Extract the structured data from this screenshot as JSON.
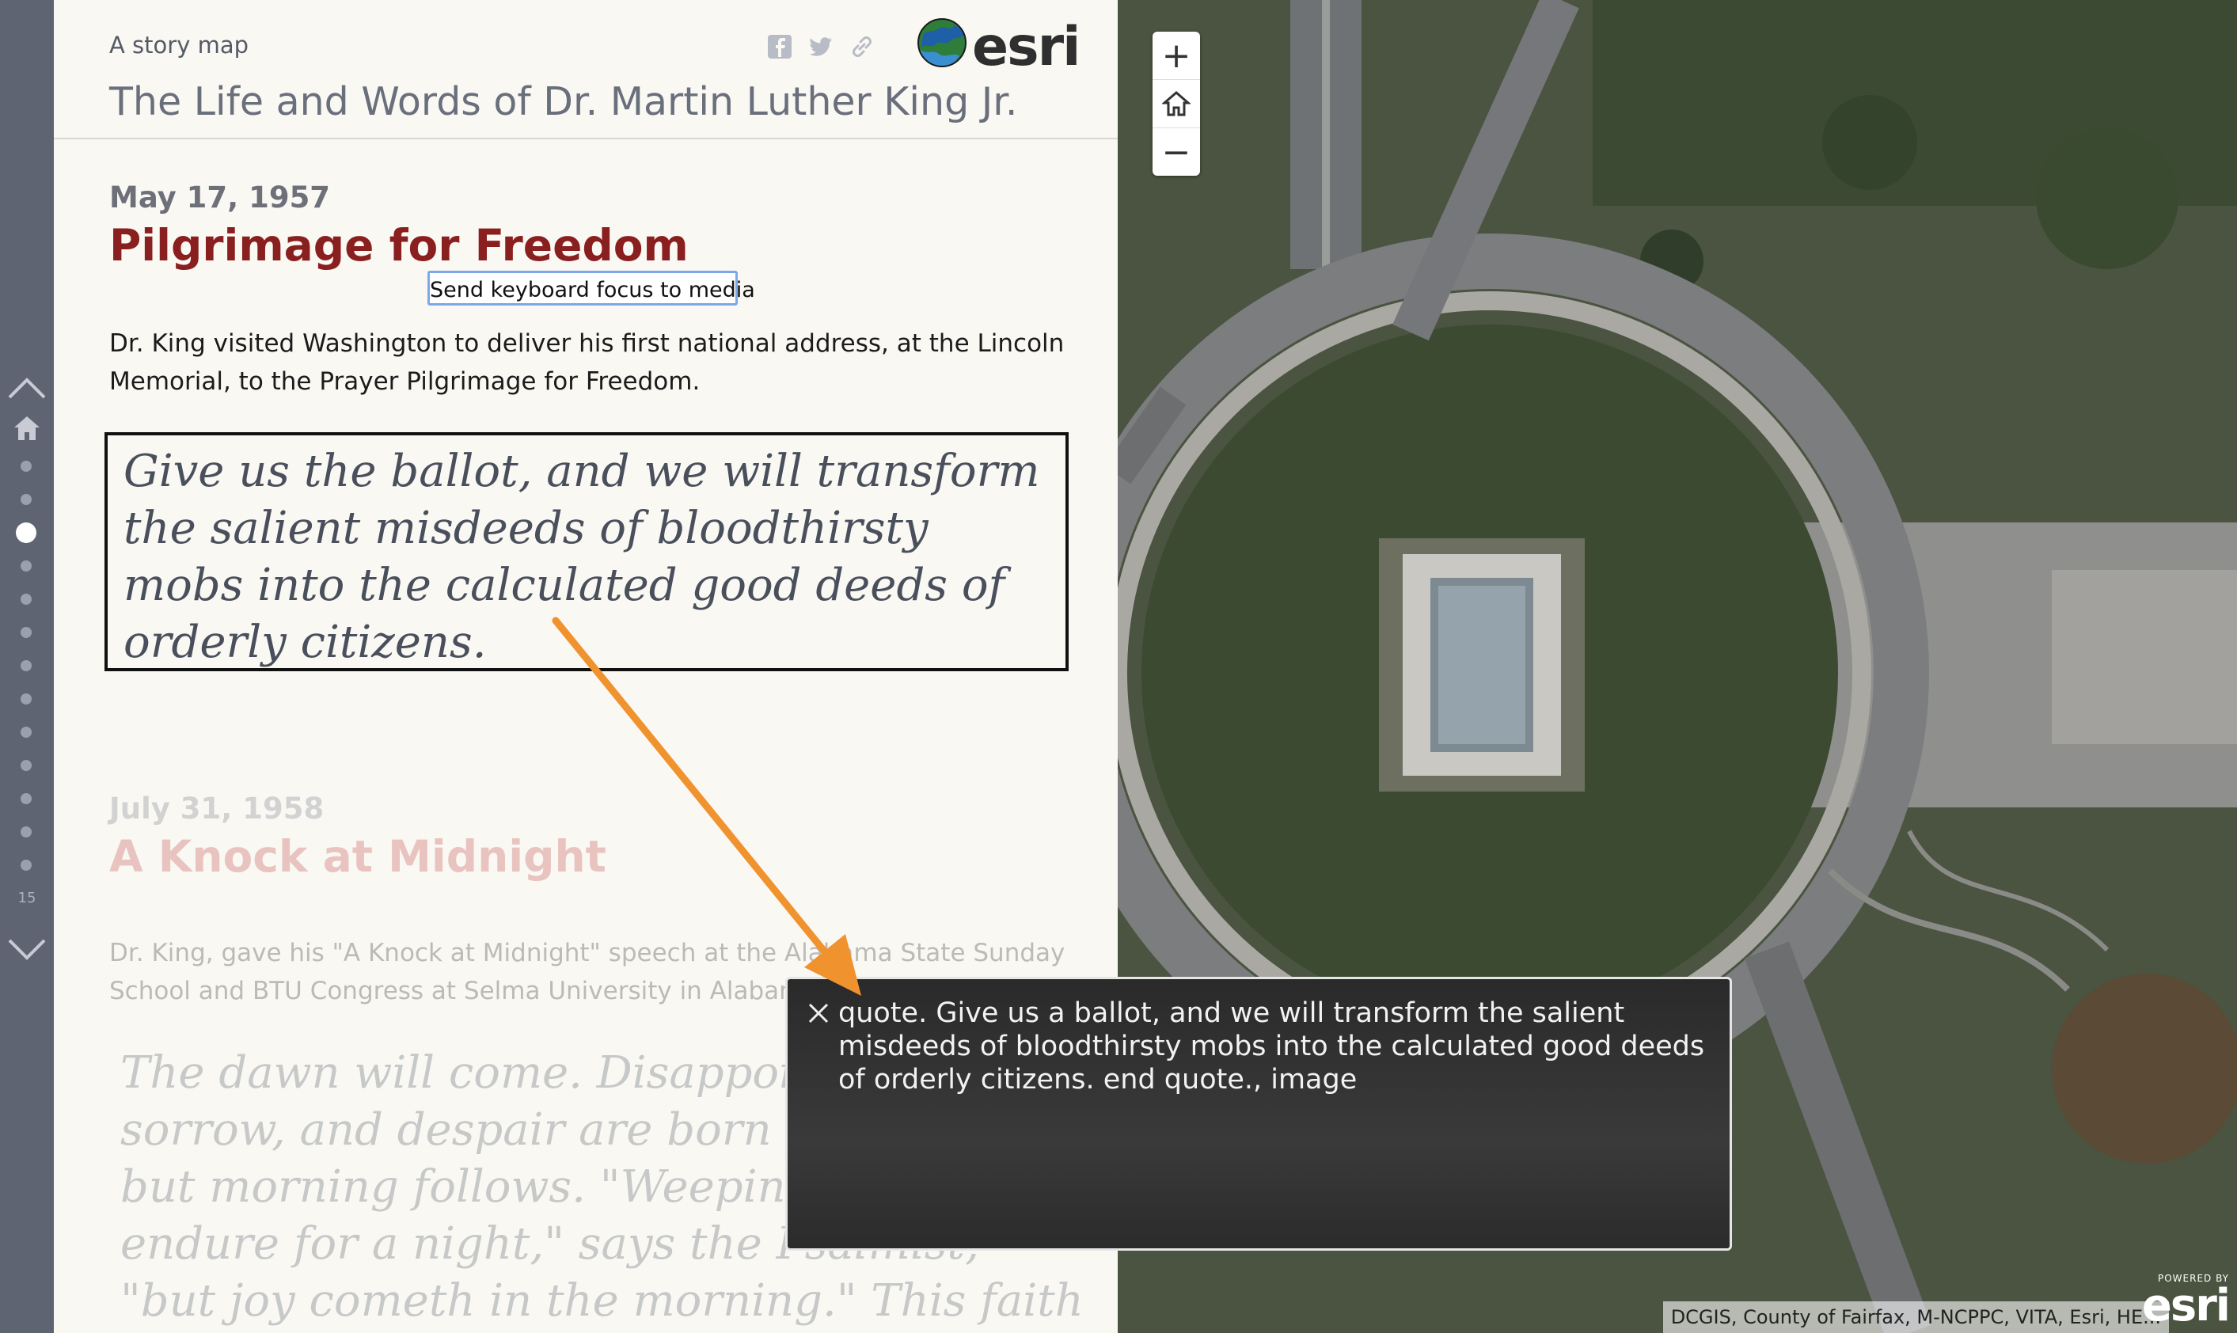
{
  "header": {
    "subtitle": "A story map",
    "title": "The Life and Words of Dr. Martin Luther King Jr.",
    "logo_text": "esri",
    "share_icons": [
      "facebook-icon",
      "twitter-icon",
      "link-icon"
    ]
  },
  "nav": {
    "count": "15",
    "active_index": 2
  },
  "sections": [
    {
      "date": "May 17, 1957",
      "headline": "Pilgrimage for Freedom",
      "focus_link": "Send keyboard focus to media",
      "body": "Dr. King visited Washington to deliver his first national address, at the Lincoln Memorial, to the Prayer Pilgrimage for Freedom.",
      "quote": "Give us the ballot, and we will transform the salient misdeeds of bloodthirsty mobs into the calculated good deeds of orderly citizens."
    },
    {
      "date": "July 31, 1958",
      "headline": "A Knock at Midnight",
      "body": "Dr. King, gave his \"A Knock at Midnight\" speech at the Alabama State Sunday School and BTU Congress at Selma University in Alabama.",
      "quote": "The dawn will come. Disappointment, sorrow, and despair are born at midnight, but morning follows. \"Weeping may endure for a night,\" says the Psalmist, \"but joy cometh in the morning.\" This faith adjourns the assemblies of"
    }
  ],
  "map": {
    "zoom_in": "+",
    "zoom_out": "−",
    "attribution": "DCGIS, County of Fairfax, M-NCPPC, VITA, Esri, HE...",
    "powered_by": "POWERED BY",
    "powered_logo": "esri"
  },
  "tooltip": {
    "text": "quote. Give us a ballot, and we will transform the salient misdeeds of bloodthirsty mobs into the calculated good deeds of orderly citizens. end quote., image"
  },
  "colors": {
    "rail": "#5f6473",
    "headline": "#8a1f1f",
    "arrow": "#f0922e"
  }
}
